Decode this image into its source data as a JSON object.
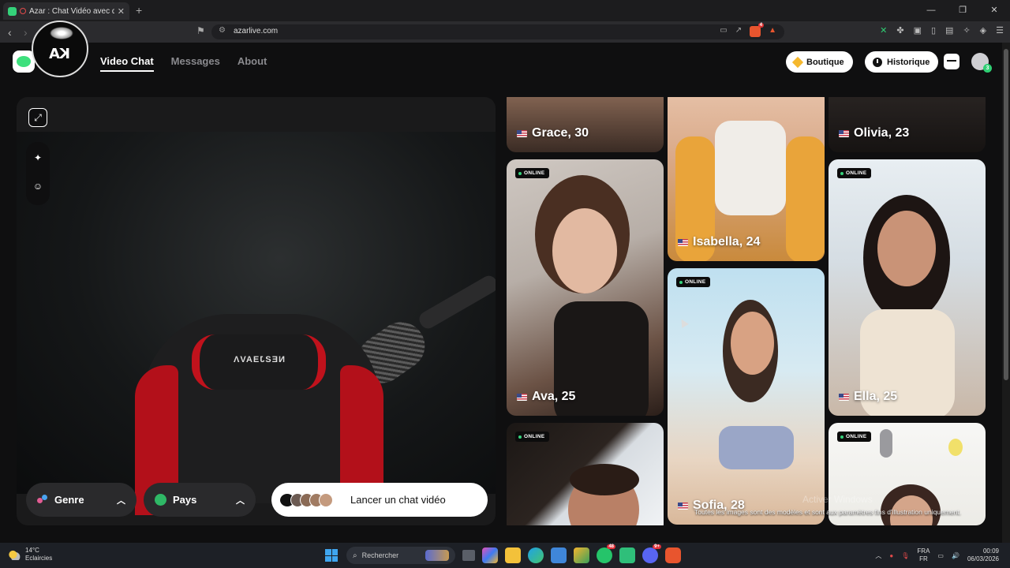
{
  "browser": {
    "tab_title": "Azar : Chat Vidéo avec de nou",
    "url": "azarlive.com",
    "shield_badge": "4",
    "window_controls": [
      "—",
      "❐",
      "✕"
    ]
  },
  "channel_badge": {
    "letters": "KA"
  },
  "nav": {
    "items": [
      {
        "label": "Video Chat",
        "active": true
      },
      {
        "label": "Messages",
        "active": false
      },
      {
        "label": "About",
        "active": false
      }
    ]
  },
  "header": {
    "boutique_label": "Boutique",
    "historique_label": "Historique",
    "avatar_badge": "3"
  },
  "video": {
    "chair_text": "NEƧJƎAVΛ",
    "genre_label": "Genre",
    "pays_label": "Pays",
    "launch_label": "Lancer un chat vidéo"
  },
  "profiles": [
    {
      "name": "Grace, 30",
      "online": false
    },
    {
      "name": "Isabella, 24",
      "online": false
    },
    {
      "name": "Olivia, 23",
      "online": false
    },
    {
      "name": "Ava, 25",
      "online": true
    },
    {
      "name": "Ella, 25",
      "online": true
    },
    {
      "name": "Sofia, 28",
      "online": true
    },
    {
      "name": "",
      "online": true
    },
    {
      "name": "",
      "online": true
    }
  ],
  "online_label": "ONLINE",
  "disclaimer": "Toutes les images sont des modèles et sont aux paramètres fins d'illustration uniquement.",
  "watermark": "Activer Windows",
  "taskbar": {
    "weather_temp": "14°C",
    "weather_desc": "Eclaircies",
    "search_placeholder": "Rechercher",
    "whatsapp_badge": "48",
    "discord_badge": "9+",
    "lang_top": "FRA",
    "lang_bottom": "FR",
    "time": "00:09",
    "date": "06/03/2026"
  },
  "colors": {
    "accent_green": "#35d27b",
    "chair_red": "#b3101a",
    "background": "#0f0f10"
  }
}
